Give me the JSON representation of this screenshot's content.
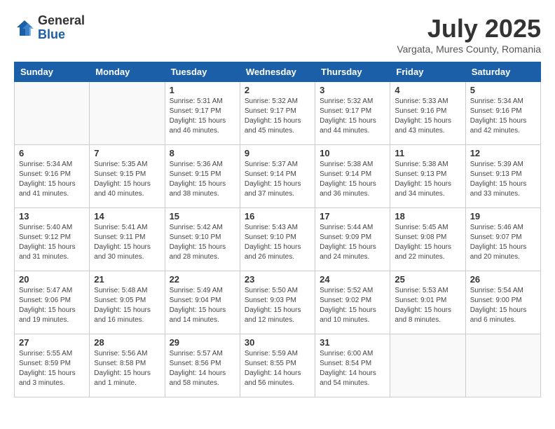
{
  "header": {
    "logo_general": "General",
    "logo_blue": "Blue",
    "month_year": "July 2025",
    "location": "Vargata, Mures County, Romania"
  },
  "weekdays": [
    "Sunday",
    "Monday",
    "Tuesday",
    "Wednesday",
    "Thursday",
    "Friday",
    "Saturday"
  ],
  "weeks": [
    [
      {
        "day": "",
        "sunrise": "",
        "sunset": "",
        "daylight": ""
      },
      {
        "day": "",
        "sunrise": "",
        "sunset": "",
        "daylight": ""
      },
      {
        "day": "1",
        "sunrise": "Sunrise: 5:31 AM",
        "sunset": "Sunset: 9:17 PM",
        "daylight": "Daylight: 15 hours and 46 minutes."
      },
      {
        "day": "2",
        "sunrise": "Sunrise: 5:32 AM",
        "sunset": "Sunset: 9:17 PM",
        "daylight": "Daylight: 15 hours and 45 minutes."
      },
      {
        "day": "3",
        "sunrise": "Sunrise: 5:32 AM",
        "sunset": "Sunset: 9:17 PM",
        "daylight": "Daylight: 15 hours and 44 minutes."
      },
      {
        "day": "4",
        "sunrise": "Sunrise: 5:33 AM",
        "sunset": "Sunset: 9:16 PM",
        "daylight": "Daylight: 15 hours and 43 minutes."
      },
      {
        "day": "5",
        "sunrise": "Sunrise: 5:34 AM",
        "sunset": "Sunset: 9:16 PM",
        "daylight": "Daylight: 15 hours and 42 minutes."
      }
    ],
    [
      {
        "day": "6",
        "sunrise": "Sunrise: 5:34 AM",
        "sunset": "Sunset: 9:16 PM",
        "daylight": "Daylight: 15 hours and 41 minutes."
      },
      {
        "day": "7",
        "sunrise": "Sunrise: 5:35 AM",
        "sunset": "Sunset: 9:15 PM",
        "daylight": "Daylight: 15 hours and 40 minutes."
      },
      {
        "day": "8",
        "sunrise": "Sunrise: 5:36 AM",
        "sunset": "Sunset: 9:15 PM",
        "daylight": "Daylight: 15 hours and 38 minutes."
      },
      {
        "day": "9",
        "sunrise": "Sunrise: 5:37 AM",
        "sunset": "Sunset: 9:14 PM",
        "daylight": "Daylight: 15 hours and 37 minutes."
      },
      {
        "day": "10",
        "sunrise": "Sunrise: 5:38 AM",
        "sunset": "Sunset: 9:14 PM",
        "daylight": "Daylight: 15 hours and 36 minutes."
      },
      {
        "day": "11",
        "sunrise": "Sunrise: 5:38 AM",
        "sunset": "Sunset: 9:13 PM",
        "daylight": "Daylight: 15 hours and 34 minutes."
      },
      {
        "day": "12",
        "sunrise": "Sunrise: 5:39 AM",
        "sunset": "Sunset: 9:13 PM",
        "daylight": "Daylight: 15 hours and 33 minutes."
      }
    ],
    [
      {
        "day": "13",
        "sunrise": "Sunrise: 5:40 AM",
        "sunset": "Sunset: 9:12 PM",
        "daylight": "Daylight: 15 hours and 31 minutes."
      },
      {
        "day": "14",
        "sunrise": "Sunrise: 5:41 AM",
        "sunset": "Sunset: 9:11 PM",
        "daylight": "Daylight: 15 hours and 30 minutes."
      },
      {
        "day": "15",
        "sunrise": "Sunrise: 5:42 AM",
        "sunset": "Sunset: 9:10 PM",
        "daylight": "Daylight: 15 hours and 28 minutes."
      },
      {
        "day": "16",
        "sunrise": "Sunrise: 5:43 AM",
        "sunset": "Sunset: 9:10 PM",
        "daylight": "Daylight: 15 hours and 26 minutes."
      },
      {
        "day": "17",
        "sunrise": "Sunrise: 5:44 AM",
        "sunset": "Sunset: 9:09 PM",
        "daylight": "Daylight: 15 hours and 24 minutes."
      },
      {
        "day": "18",
        "sunrise": "Sunrise: 5:45 AM",
        "sunset": "Sunset: 9:08 PM",
        "daylight": "Daylight: 15 hours and 22 minutes."
      },
      {
        "day": "19",
        "sunrise": "Sunrise: 5:46 AM",
        "sunset": "Sunset: 9:07 PM",
        "daylight": "Daylight: 15 hours and 20 minutes."
      }
    ],
    [
      {
        "day": "20",
        "sunrise": "Sunrise: 5:47 AM",
        "sunset": "Sunset: 9:06 PM",
        "daylight": "Daylight: 15 hours and 19 minutes."
      },
      {
        "day": "21",
        "sunrise": "Sunrise: 5:48 AM",
        "sunset": "Sunset: 9:05 PM",
        "daylight": "Daylight: 15 hours and 16 minutes."
      },
      {
        "day": "22",
        "sunrise": "Sunrise: 5:49 AM",
        "sunset": "Sunset: 9:04 PM",
        "daylight": "Daylight: 15 hours and 14 minutes."
      },
      {
        "day": "23",
        "sunrise": "Sunrise: 5:50 AM",
        "sunset": "Sunset: 9:03 PM",
        "daylight": "Daylight: 15 hours and 12 minutes."
      },
      {
        "day": "24",
        "sunrise": "Sunrise: 5:52 AM",
        "sunset": "Sunset: 9:02 PM",
        "daylight": "Daylight: 15 hours and 10 minutes."
      },
      {
        "day": "25",
        "sunrise": "Sunrise: 5:53 AM",
        "sunset": "Sunset: 9:01 PM",
        "daylight": "Daylight: 15 hours and 8 minutes."
      },
      {
        "day": "26",
        "sunrise": "Sunrise: 5:54 AM",
        "sunset": "Sunset: 9:00 PM",
        "daylight": "Daylight: 15 hours and 6 minutes."
      }
    ],
    [
      {
        "day": "27",
        "sunrise": "Sunrise: 5:55 AM",
        "sunset": "Sunset: 8:59 PM",
        "daylight": "Daylight: 15 hours and 3 minutes."
      },
      {
        "day": "28",
        "sunrise": "Sunrise: 5:56 AM",
        "sunset": "Sunset: 8:58 PM",
        "daylight": "Daylight: 15 hours and 1 minute."
      },
      {
        "day": "29",
        "sunrise": "Sunrise: 5:57 AM",
        "sunset": "Sunset: 8:56 PM",
        "daylight": "Daylight: 14 hours and 58 minutes."
      },
      {
        "day": "30",
        "sunrise": "Sunrise: 5:59 AM",
        "sunset": "Sunset: 8:55 PM",
        "daylight": "Daylight: 14 hours and 56 minutes."
      },
      {
        "day": "31",
        "sunrise": "Sunrise: 6:00 AM",
        "sunset": "Sunset: 8:54 PM",
        "daylight": "Daylight: 14 hours and 54 minutes."
      },
      {
        "day": "",
        "sunrise": "",
        "sunset": "",
        "daylight": ""
      },
      {
        "day": "",
        "sunrise": "",
        "sunset": "",
        "daylight": ""
      }
    ]
  ]
}
